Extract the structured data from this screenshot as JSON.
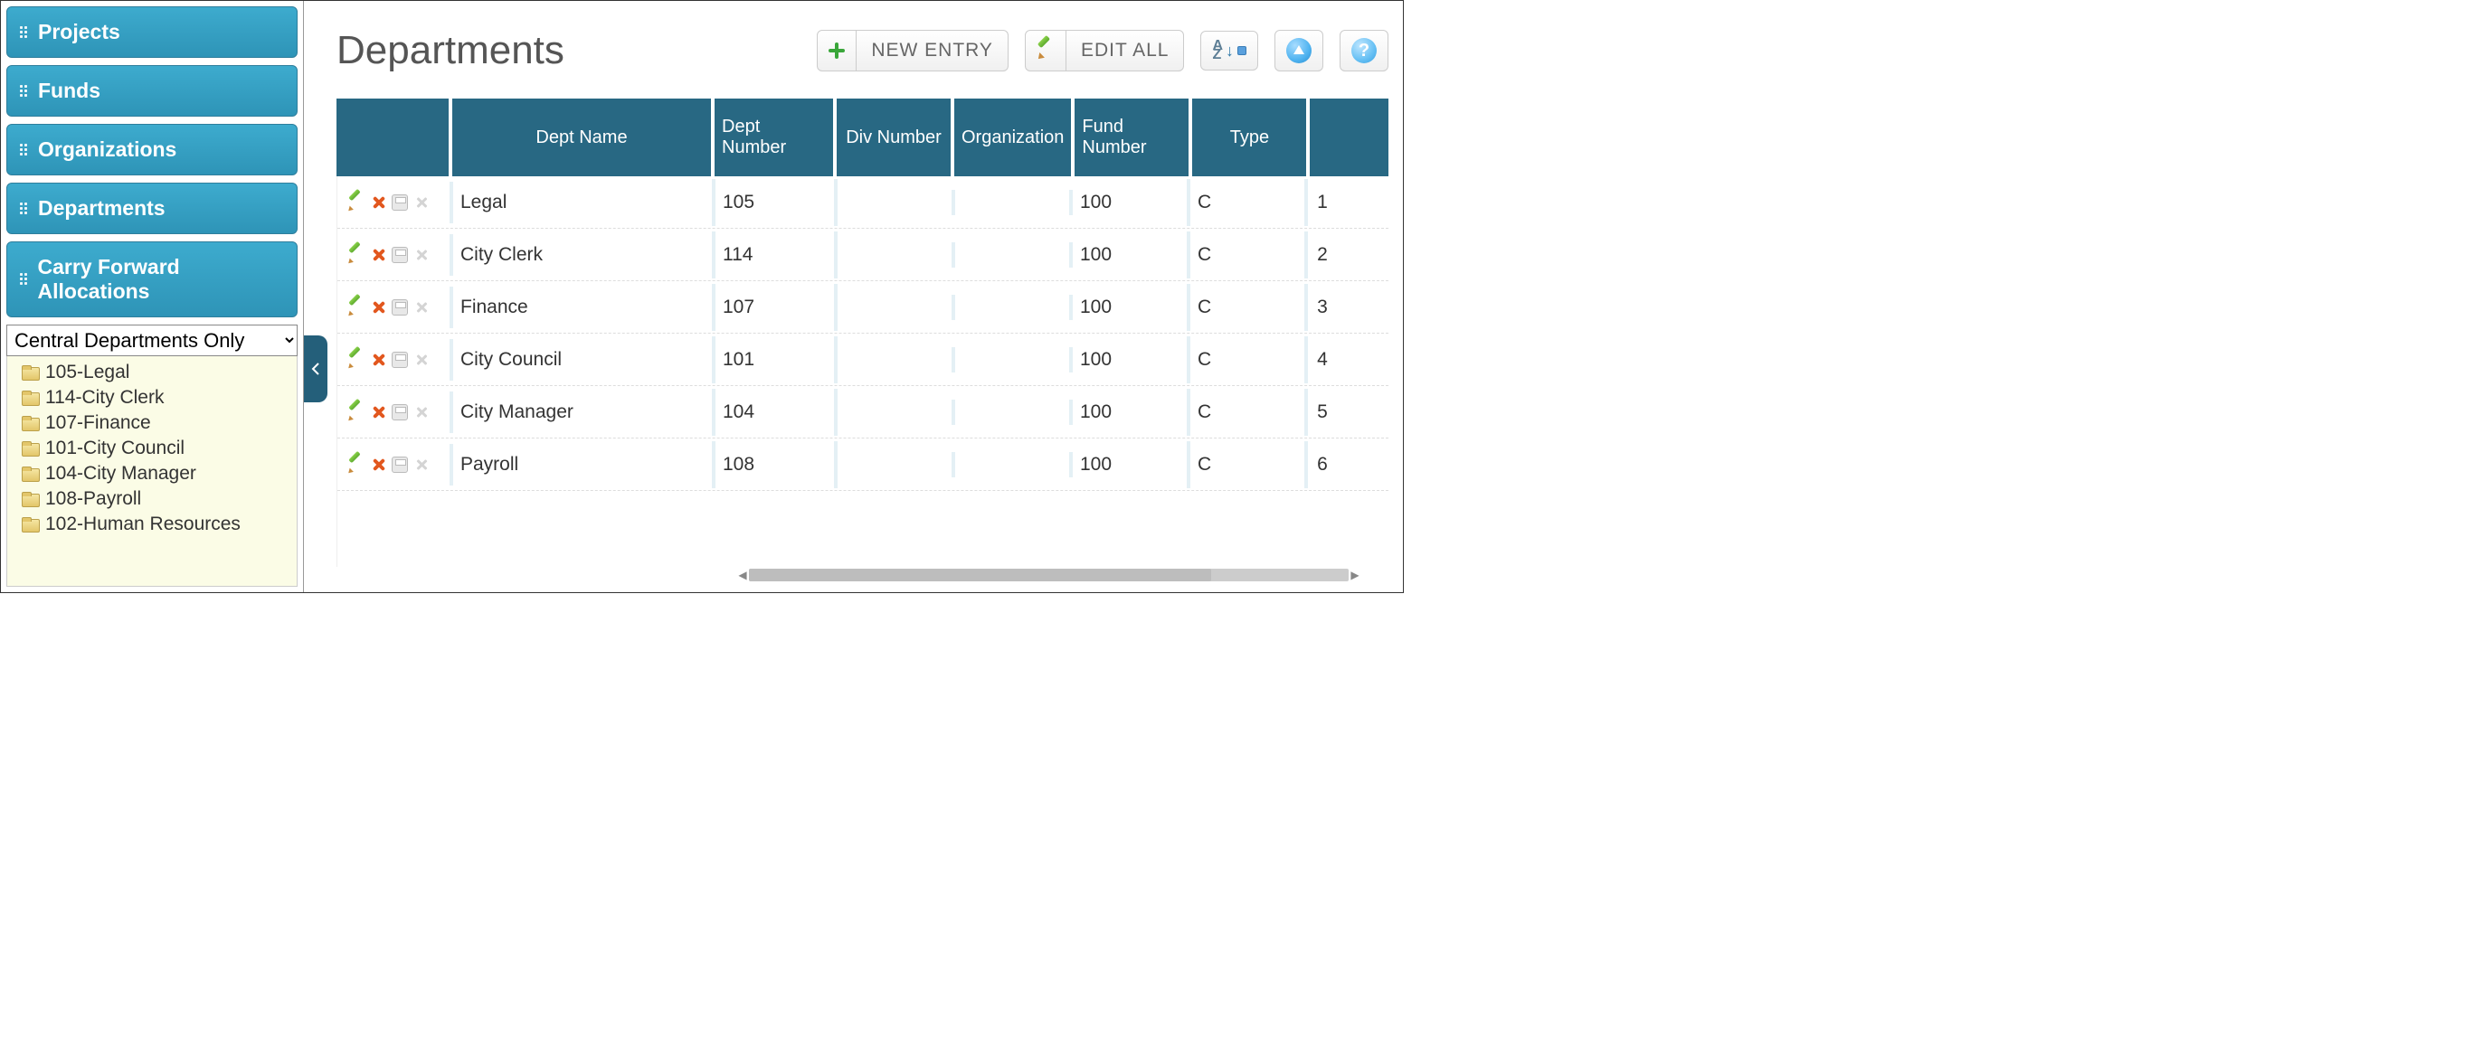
{
  "sidebar": {
    "nav": [
      {
        "label": "Projects"
      },
      {
        "label": "Funds"
      },
      {
        "label": "Organizations"
      },
      {
        "label": "Departments"
      },
      {
        "label": "Carry Forward Allocations"
      }
    ],
    "filter_selected": "Central Departments Only",
    "tree": [
      {
        "label": "105-Legal"
      },
      {
        "label": "114-City Clerk"
      },
      {
        "label": "107-Finance"
      },
      {
        "label": "101-City Council"
      },
      {
        "label": "104-City Manager"
      },
      {
        "label": "108-Payroll"
      },
      {
        "label": "102-Human Resources"
      }
    ]
  },
  "header": {
    "title": "Departments",
    "new_entry_label": "NEW ENTRY",
    "edit_all_label": "EDIT ALL"
  },
  "table": {
    "columns": {
      "dept_name": "Dept Name",
      "dept_number": "Dept Number",
      "div_number": "Div Number",
      "organization": "Organization",
      "fund_number": "Fund Number",
      "type": "Type"
    },
    "rows": [
      {
        "dept_name": "Legal",
        "dept_number": "105",
        "div_number": "",
        "organization": "",
        "fund_number": "100",
        "type": "C",
        "index": "1"
      },
      {
        "dept_name": "City Clerk",
        "dept_number": "114",
        "div_number": "",
        "organization": "",
        "fund_number": "100",
        "type": "C",
        "index": "2"
      },
      {
        "dept_name": "Finance",
        "dept_number": "107",
        "div_number": "",
        "organization": "",
        "fund_number": "100",
        "type": "C",
        "index": "3"
      },
      {
        "dept_name": "City Council",
        "dept_number": "101",
        "div_number": "",
        "organization": "",
        "fund_number": "100",
        "type": "C",
        "index": "4"
      },
      {
        "dept_name": "City Manager",
        "dept_number": "104",
        "div_number": "",
        "organization": "",
        "fund_number": "100",
        "type": "C",
        "index": "5"
      },
      {
        "dept_name": "Payroll",
        "dept_number": "108",
        "div_number": "",
        "organization": "",
        "fund_number": "100",
        "type": "C",
        "index": "6"
      }
    ]
  }
}
